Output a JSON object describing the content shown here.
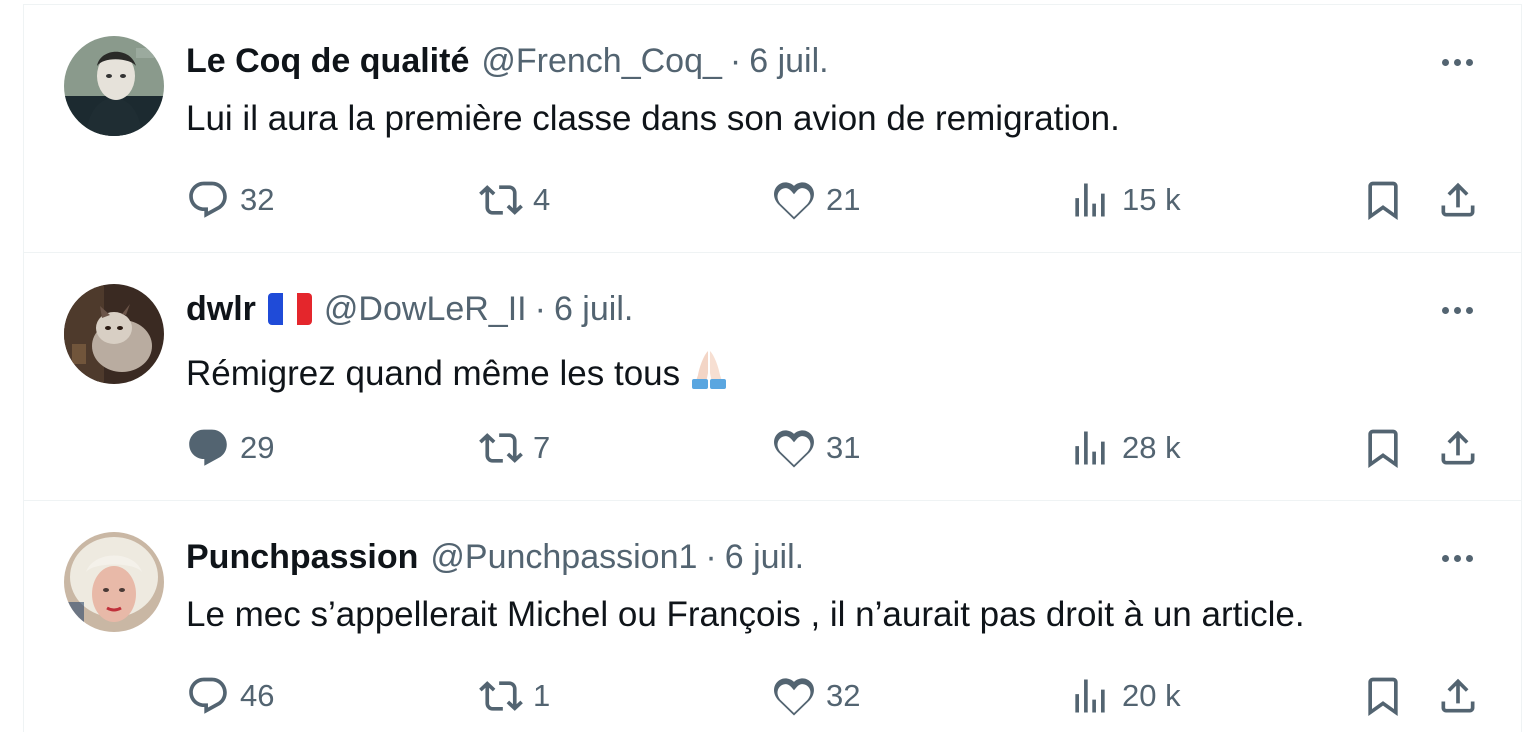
{
  "tweets": [
    {
      "name": "Le Coq de qualité",
      "handle": "@French_Coq_",
      "separator": "·",
      "date": "6 juil.",
      "text": "Lui il aura la première classe dans son avion de remigration.",
      "replies": "32",
      "retweets": "4",
      "likes": "21",
      "views": "15 k",
      "avatar_icon": "masked-figure-avatar"
    },
    {
      "name": "dwlr",
      "name_badge": "france-flag-emoji",
      "handle": "@DowLeR_II",
      "separator": "·",
      "date": "6 juil.",
      "text": "Rémigrez quand même les tous",
      "text_emoji": "folded-hands-emoji",
      "replies": "29",
      "retweets": "7",
      "likes": "31",
      "views": "28 k",
      "avatar_icon": "cat-avatar"
    },
    {
      "name": "Punchpassion",
      "handle": "@Punchpassion1",
      "separator": "·",
      "date": "6 juil.",
      "text": "Le mec s’appellerait Michel ou François , il n’aurait pas droit à un article.",
      "replies": "46",
      "retweets": "1",
      "likes": "32",
      "views": "20 k",
      "avatar_icon": "blonde-woman-avatar"
    }
  ],
  "colors": {
    "text_primary": "#0f1419",
    "text_secondary": "#536471",
    "divider": "#eff3f4"
  },
  "icons": [
    "reply-icon",
    "retweet-icon",
    "like-icon",
    "views-icon",
    "bookmark-icon",
    "share-icon",
    "more-icon"
  ]
}
